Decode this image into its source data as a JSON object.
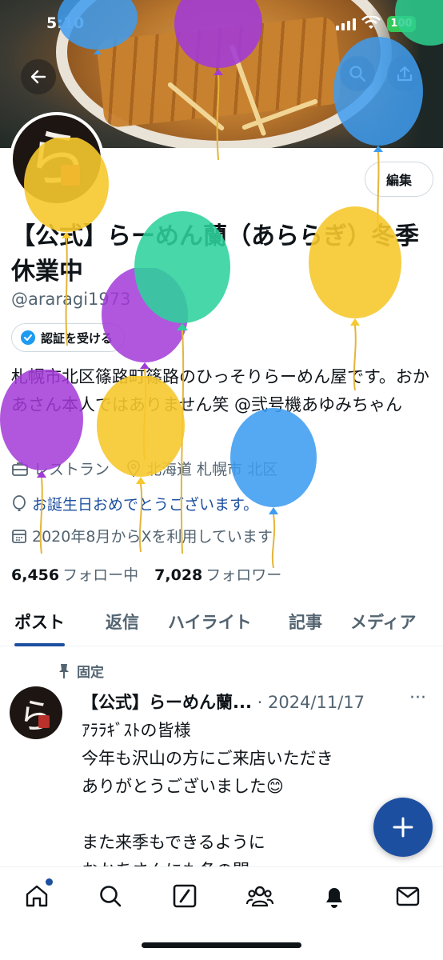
{
  "status_bar": {
    "time": "5:10",
    "battery": "100"
  },
  "profile": {
    "name": "【公式】らーめん蘭（あららぎ）冬季休業中",
    "handle": "@araragi1973",
    "edit_label": "編集",
    "verify_label": "認証を受ける",
    "bio": "札幌市北区篠路町篠路のひっそりらーめん屋です。おかあさん本人ではありません笑 @弐号機あゆみちゃん",
    "category": "レストラン",
    "location": "北海道 札幌市 北区",
    "birthday": "お誕生日おめでとうございます。",
    "joined": "2020年8月からXを利用しています",
    "following_count": "6,456",
    "following_label": "フォロー中",
    "followers_count": "7,028",
    "followers_label": "フォロワー"
  },
  "tabs": [
    "ポスト",
    "返信",
    "ハイライト",
    "記事",
    "メディア"
  ],
  "post": {
    "pinned_label": "固定",
    "author": "【公式】らーめん蘭...",
    "date": "· 2024/11/17",
    "more": "···",
    "body": "ｱﾗﾗｷﾞｽﾄの皆様\n今年も沢山の方にご来店いただき\nありがとうございました😊\n\nまた来季もできるように\nおかあさんにも冬の間"
  },
  "avatar_glyph": "ら",
  "colors": {
    "accent": "#1d4fa0",
    "verified": "#1d9bf0"
  },
  "icons": [
    "back-arrow-icon",
    "search-icon",
    "share-icon",
    "verified-check-icon",
    "briefcase-icon",
    "location-pin-icon",
    "balloon-icon",
    "calendar-icon",
    "pin-icon",
    "home-icon",
    "search-icon",
    "grok-icon",
    "communities-icon",
    "notifications-icon",
    "messages-icon",
    "compose-plus-icon"
  ]
}
